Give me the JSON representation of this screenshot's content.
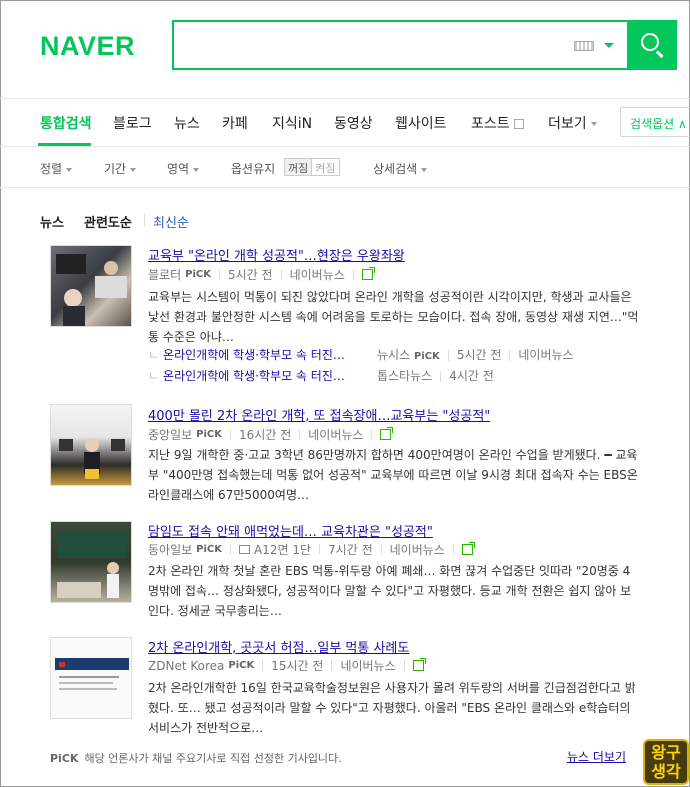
{
  "header": {
    "logo": "NAVER",
    "search_value": ""
  },
  "tabs": [
    {
      "label": "통합검색",
      "active": true
    },
    {
      "label": "블로그"
    },
    {
      "label": "뉴스"
    },
    {
      "label": "카페"
    },
    {
      "label": "지식iN"
    },
    {
      "label": "동영상"
    },
    {
      "label": "웹사이트"
    },
    {
      "label": "포스트"
    },
    {
      "label": "더보기"
    }
  ],
  "search_options_label": "검색옵션",
  "options": {
    "sort": "정렬",
    "period": "기간",
    "area": "영역",
    "keep": "옵션유지",
    "keep_on": "꺼짐",
    "keep_off": "켜짐",
    "detail": "상세검색"
  },
  "section": {
    "title": "뉴스",
    "sort_relevance": "관련도순",
    "sort_latest": "최신순"
  },
  "articles": [
    {
      "title": "교육부 \"온라인 개학 성공적\"…현장은 우왕좌왕",
      "press": "블로터",
      "pick": "PiCK",
      "time": "5시간 전",
      "source": "네이버뉴스",
      "desc": "교육부는 시스템이 먹통이 되진 않았다며 온라인 개학을 성공적이란 시각이지만, 학생과 교사들은 낯선 환경과 불안정한 시스템 속에 어려움을 토로하는 모습이다. 접속 장애, 동영상 재생 지연…\"먹통 수준은 아냐…",
      "subs": [
        {
          "title": "온라인개학에 학생·학부모 속 터진…",
          "press": "뉴시스",
          "pick": "PiCK",
          "time": "5시간 전",
          "source": "네이버뉴스"
        },
        {
          "title": "온라인개학에 학생·학부모 속 터진…",
          "press": "톱스타뉴스",
          "time": "4시간 전"
        }
      ]
    },
    {
      "title": "400만 몰린 2차 온라인 개학, 또 접속장애…교육부는 \"성공적\"",
      "press": "중앙일보",
      "pick": "PiCK",
      "time": "16시간 전",
      "source": "네이버뉴스",
      "desc": "지난 9일 개학한 중·고교 3학년 86만명까지 합하면 400만여명이 온라인 수업을 받게됐다. ━ 교육부 \"400만명 접속했는데 먹통 없어 성공적\" 교육부에 따르면 이날 9시경 최대 접속자 수는 EBS온라인클래스에 67만5000여명…"
    },
    {
      "title": "담임도 접속 안돼 애먹었는데… 교육차관은 \"성공적\"",
      "press": "동아일보",
      "pick": "PiCK",
      "paper": "A12면 1단",
      "time": "7시간 전",
      "source": "네이버뉴스",
      "desc": "2차 온라인 개학 첫날 혼란 EBS 먹통-위두랑 아예 폐쇄… 화면 끊겨 수업중단 잇따라 \"20명중 4명밖에 접속… 정상화됐다, 성공적이다 말할 수 있다\"고 자평했다. 등교 개학 전환은 쉽지 않아 보인다. 정세균 국무총리는…"
    },
    {
      "title": "2차 온라인개학, 곳곳서 허점…일부 먹통 사례도",
      "press": "ZDNet Korea",
      "pick": "PiCK",
      "time": "15시간 전",
      "source": "네이버뉴스",
      "desc": "2차 온라인개학한 16일 한국교육학술정보원은 사용자가 몰려 위두랑의 서버를 긴급점검한다고 밝혔다. 또… 됐고 성공적이라 말할 수 있다\"고 자평했다. 아울러 \"EBS 온라인 클래스와 e학습터의 서비스가 전반적으로…"
    }
  ],
  "footer": {
    "pick": "PiCK",
    "note": "해당 언론사가 채널 주요기사로 직접 선정한 기사입니다.",
    "more": "뉴스 더보기"
  },
  "watermark": "왕구 생각",
  "colors": {
    "brand": "#03c75a",
    "link": "#1a0dab"
  }
}
